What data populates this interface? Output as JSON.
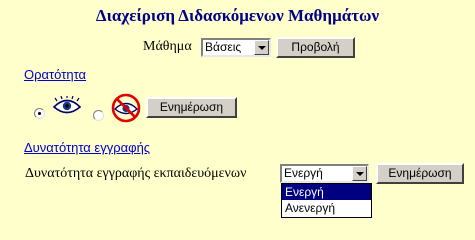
{
  "page": {
    "title": "Διαχείριση Διδασκόμενων Μαθημάτων"
  },
  "course_selector": {
    "label": "Μάθημα",
    "selected": "Βάσεις",
    "view_button": "Προβολή"
  },
  "visibility": {
    "heading": "Ορατότητα",
    "option_visible_checked": true,
    "option_hidden_checked": false,
    "update_button": "Ενημέρωση"
  },
  "enrollment": {
    "heading": "Δυνατότητα εγγραφής",
    "label": "Δυνατότητα εγγραφής εκπαιδευόμενων",
    "selected": "Ενεργή",
    "options": [
      "Ενεργή",
      "Ανενεργή"
    ],
    "update_button": "Ενημέρωση"
  },
  "colors": {
    "background": "#FFFFCC",
    "title": "#00008B",
    "link": "#0000CC",
    "selection": "#000080"
  },
  "icons": {
    "visible": "eye-icon",
    "hidden": "eye-crossed-icon"
  }
}
